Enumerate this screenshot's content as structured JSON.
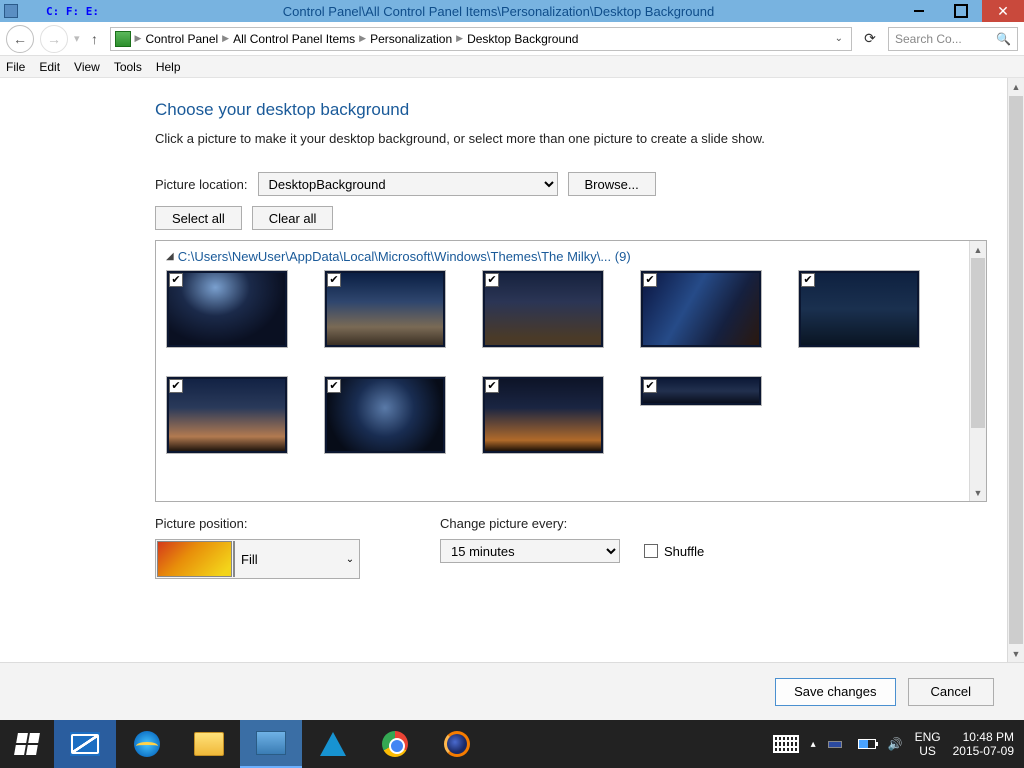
{
  "titlebar": {
    "pager": "C: F: E:",
    "title": "Control Panel\\All Control Panel Items\\Personalization\\Desktop Background"
  },
  "breadcrumb": {
    "items": [
      "Control Panel",
      "All Control Panel Items",
      "Personalization",
      "Desktop Background"
    ]
  },
  "search": {
    "placeholder": "Search Co..."
  },
  "menu": {
    "file": "File",
    "edit": "Edit",
    "view": "View",
    "tools": "Tools",
    "help": "Help"
  },
  "page": {
    "title": "Choose your desktop background",
    "desc": "Click a picture to make it your desktop background, or select more than one picture to create a slide show."
  },
  "location": {
    "label": "Picture location:",
    "value": "DesktopBackground",
    "browse": "Browse..."
  },
  "buttons": {
    "select_all": "Select all",
    "clear_all": "Clear all"
  },
  "group": {
    "path": "C:\\Users\\NewUser\\AppData\\Local\\Microsoft\\Windows\\Themes\\The Milky\\... (9)"
  },
  "position": {
    "label": "Picture position:",
    "value": "Fill"
  },
  "change": {
    "label": "Change picture every:",
    "value": "15 minutes",
    "shuffle": "Shuffle"
  },
  "footer": {
    "save": "Save changes",
    "cancel": "Cancel"
  },
  "taskbar": {
    "lang1": "ENG",
    "lang2": "US",
    "time": "10:48 PM",
    "date": "2015-07-09"
  }
}
